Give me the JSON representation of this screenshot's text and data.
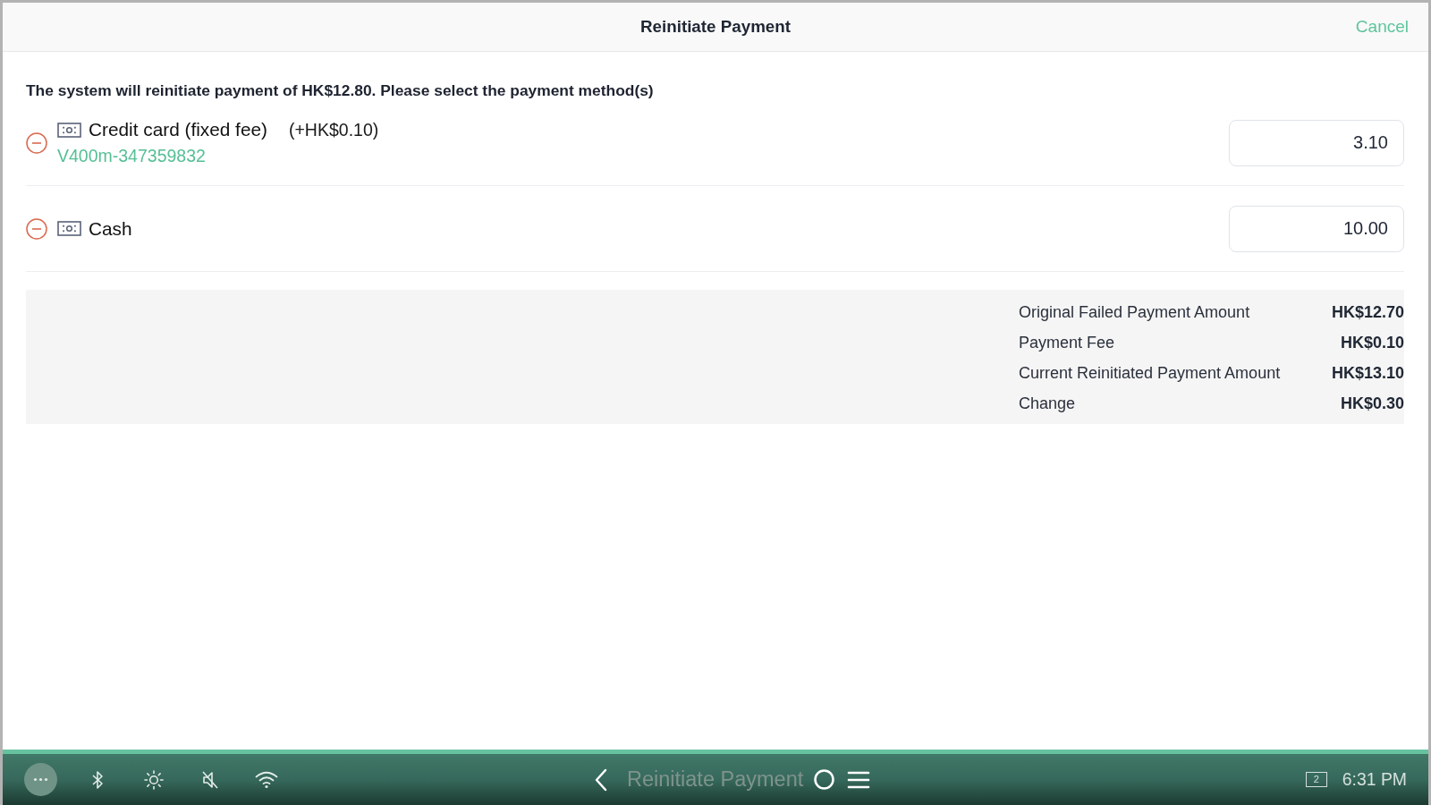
{
  "header": {
    "title": "Reinitiate Payment",
    "cancel": "Cancel"
  },
  "instruction": "The system will reinitiate payment of HK$12.80. Please select the payment method(s)",
  "payment_methods": [
    {
      "name": "Credit card (fixed fee)",
      "fee": "(+HK$0.10)",
      "terminal": "V400m-347359832",
      "amount": "3.10"
    },
    {
      "name": "Cash",
      "amount": "10.00"
    }
  ],
  "summary": [
    {
      "label": "Original Failed Payment Amount",
      "value": "HK$12.70"
    },
    {
      "label": "Payment Fee",
      "value": "HK$0.10"
    },
    {
      "label": "Current Reinitiated Payment Amount",
      "value": "HK$13.10"
    },
    {
      "label": "Change",
      "value": "HK$0.30"
    }
  ],
  "navigation_bar": {
    "app_title": "Reinitiate Payment",
    "notification_count": "2",
    "time": "6:31 PM"
  }
}
